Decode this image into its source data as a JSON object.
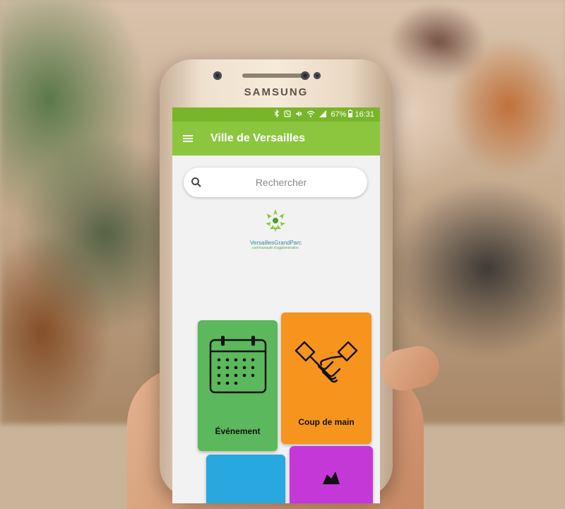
{
  "device": {
    "brand": "SAMSUNG"
  },
  "status_bar": {
    "battery": "67%",
    "time": "16:31"
  },
  "app_bar": {
    "title": "Ville de Versailles"
  },
  "search": {
    "placeholder": "Rechercher"
  },
  "logo": {
    "name": "VersaillesGrandParc",
    "subtitle": "communauté d'agglomération"
  },
  "tiles": [
    {
      "label": "Événement",
      "color": "#5cb85c",
      "icon": "calendar-icon"
    },
    {
      "label": "Coup de main",
      "color": "#f7941d",
      "icon": "handshake-icon"
    },
    {
      "label": "",
      "color": "#29a8e0",
      "icon": ""
    },
    {
      "label": "",
      "color": "#c438d8",
      "icon": ""
    }
  ],
  "colors": {
    "status_bar": "#79b52b",
    "app_bar": "#8cc63f"
  }
}
